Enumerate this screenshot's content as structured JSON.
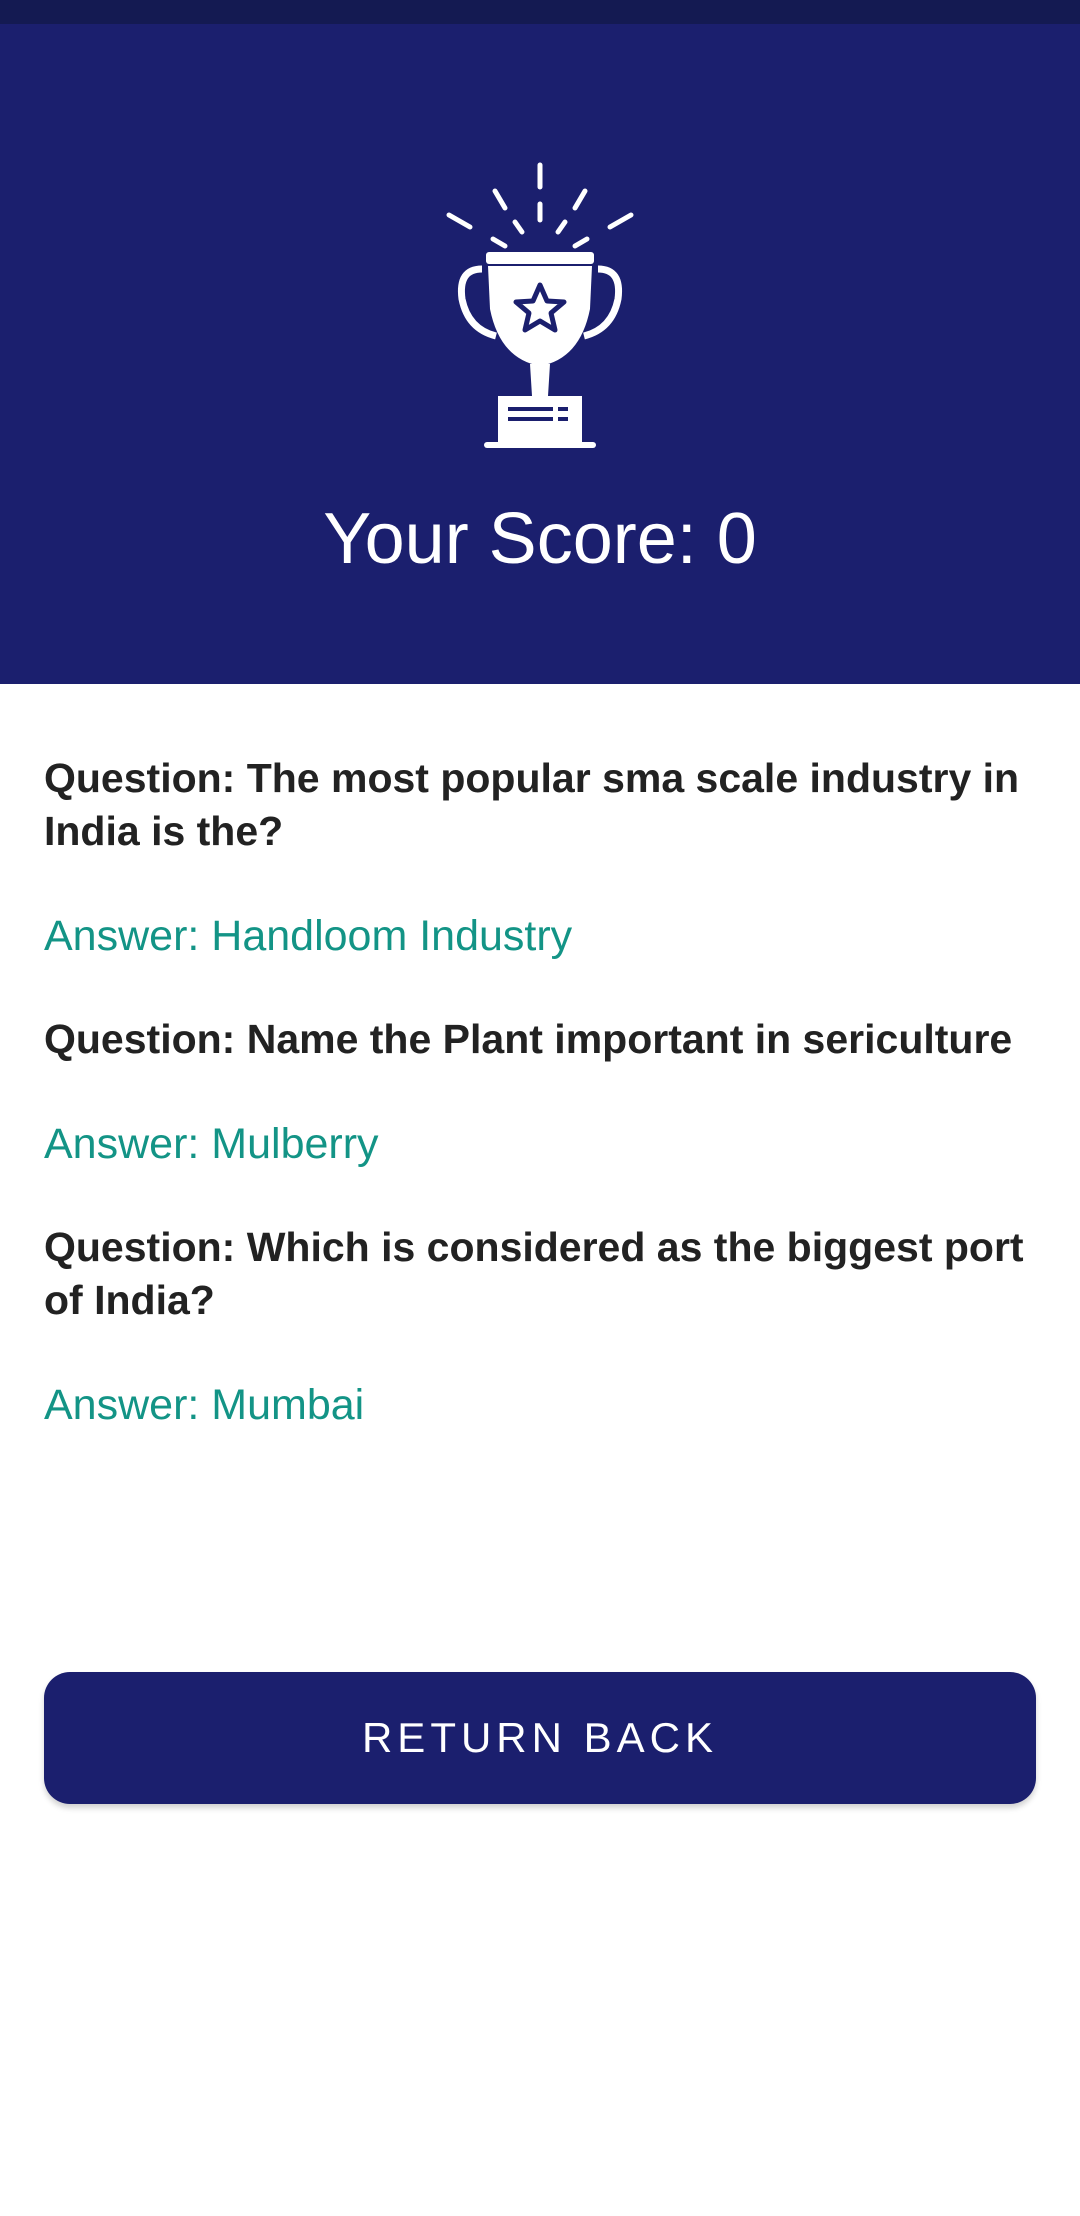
{
  "colors": {
    "header_bg": "#1b1f6e",
    "status_bar_bg": "#141a52",
    "answer_text": "#139486",
    "question_text": "#222222",
    "button_bg": "#1b1f6e"
  },
  "header": {
    "icon": "trophy-icon",
    "score_text": "Your Score: 0"
  },
  "results": [
    {
      "question": "Question: The most popular sma scale industry in India is the?",
      "answer": "Answer: Handloom Industry"
    },
    {
      "question": "Question: Name the Plant important in sericulture",
      "answer": "Answer: Mulberry"
    },
    {
      "question": "Question: Which is considered as the biggest port of India?",
      "answer": "Answer: Mumbai"
    }
  ],
  "actions": {
    "return_label": "RETURN BACK"
  }
}
